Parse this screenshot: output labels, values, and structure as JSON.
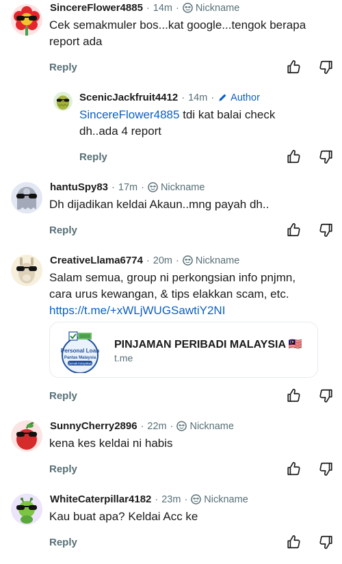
{
  "comments": [
    {
      "username": "SincereFlower4885",
      "time": "14m",
      "tag": "Nickname",
      "avatar": "flower-avatar",
      "text": "Cek semakmuler bos...kat google...tengok berapa report ada",
      "line1": "Cek semakmuler bos...kat google...tengok berapa",
      "line2": "report ada",
      "reply_label": "Reply"
    },
    {
      "username": "ScenicJackfruit4412",
      "time": "14m",
      "tag": "Author",
      "avatar": "jackfruit-avatar",
      "mention": "SincereFlower4885",
      "line1_rest": " tdi kat balai check",
      "line2": "dh..ada 4 report",
      "reply_label": "Reply"
    },
    {
      "username": "hantuSpy83",
      "time": "17m",
      "tag": "Nickname",
      "avatar": "ghost-avatar",
      "text": "Dh dijadikan keldai Akaun..mng payah dh..",
      "reply_label": "Reply"
    },
    {
      "username": "CreativeLlama6774",
      "time": "20m",
      "tag": "Nickname",
      "avatar": "llama-avatar",
      "line1": "Salam semua, group ni perkongsian info pnjmn,",
      "line2": "cara urus kewangan, & tips elakkan scam, etc.",
      "link": "https://t.me/+xWLjWUGSawtiY2NI",
      "reply_label": "Reply",
      "preview": {
        "title": "PINJAMAN PERIBADI MALAYSIA 🇲🇾",
        "domain": "t.me",
        "thumb_line1": "Personal Loan",
        "thumb_line2": "Pantas Malaysia",
        "thumb_line3": "Semak Kelayakan"
      }
    },
    {
      "username": "SunnyCherry2896",
      "time": "22m",
      "tag": "Nickname",
      "avatar": "cherry-avatar",
      "text": "kena kes keldai ni habis",
      "reply_label": "Reply"
    },
    {
      "username": "WhiteCaterpillar4182",
      "time": "23m",
      "tag": "Nickname",
      "avatar": "caterpillar-avatar",
      "text": "Kau buat apa? Keldai Acc ke",
      "reply_label": "Reply"
    }
  ],
  "dot": "·",
  "colors": {
    "meta": "#576f76",
    "link": "#0a5fc2",
    "text": "#1a1a1b"
  },
  "icons": {
    "upvote": "thumbs-up-icon",
    "downvote": "thumbs-down-icon",
    "nickname": "avatar-badge-icon",
    "author": "pencil-icon"
  }
}
